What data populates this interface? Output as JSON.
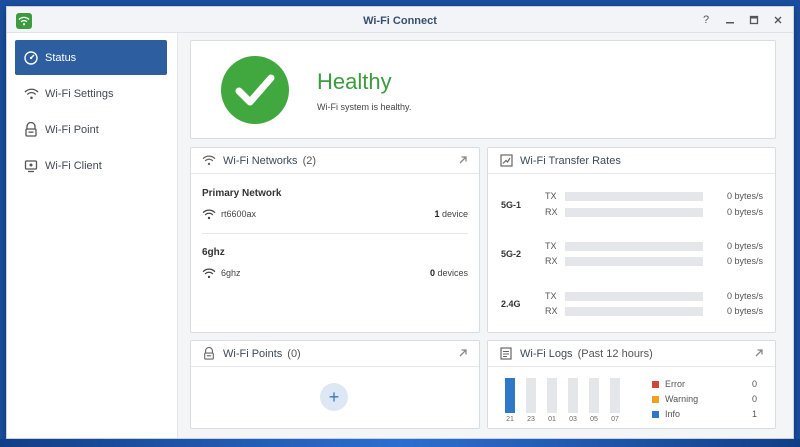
{
  "window": {
    "title": "Wi-Fi Connect"
  },
  "colors": {
    "accent": "#2c5ea0",
    "healthy": "#40a83f",
    "error": "#d0443a",
    "warning": "#f0a11d",
    "info": "#2f78c8"
  },
  "sidebar": {
    "items": [
      {
        "label": "Status",
        "icon": "status-icon",
        "active": true
      },
      {
        "label": "Wi-Fi Settings",
        "icon": "wifi-icon",
        "active": false
      },
      {
        "label": "Wi-Fi Point",
        "icon": "wifi-point-icon",
        "active": false
      },
      {
        "label": "Wi-Fi Client",
        "icon": "client-icon",
        "active": false
      }
    ]
  },
  "health": {
    "status": "Healthy",
    "description": "Wi-Fi system is healthy."
  },
  "networks": {
    "title": "Wi-Fi Networks",
    "count": "(2)",
    "groups": [
      {
        "name": "Primary Network",
        "ssid": "rt6600ax",
        "count": "1",
        "unit": "device"
      },
      {
        "name": "6ghz",
        "ssid": "6ghz",
        "count": "0",
        "unit": "devices"
      }
    ]
  },
  "rates": {
    "title": "Wi-Fi Transfer Rates",
    "bands": [
      {
        "band": "5G-1",
        "tx_label": "TX",
        "tx_value": "0 bytes/s",
        "rx_label": "RX",
        "rx_value": "0 bytes/s"
      },
      {
        "band": "5G-2",
        "tx_label": "TX",
        "tx_value": "0 bytes/s",
        "rx_label": "RX",
        "rx_value": "0 bytes/s"
      },
      {
        "band": "2.4G",
        "tx_label": "TX",
        "tx_value": "0 bytes/s",
        "rx_label": "RX",
        "rx_value": "0 bytes/s"
      }
    ]
  },
  "points": {
    "title": "Wi-Fi Points",
    "count": "(0)",
    "add_label": "+"
  },
  "logs": {
    "title": "Wi-Fi Logs",
    "subtitle": "(Past 12 hours)",
    "chart_data": {
      "type": "bar",
      "categories": [
        "21",
        "23",
        "01",
        "03",
        "05",
        "07"
      ],
      "values": [
        1,
        0,
        0,
        0,
        0,
        0
      ],
      "ylim": [
        0,
        1
      ]
    },
    "legend": [
      {
        "label": "Error",
        "count": "0",
        "color": "#d0443a"
      },
      {
        "label": "Warning",
        "count": "0",
        "color": "#f0a11d"
      },
      {
        "label": "Info",
        "count": "1",
        "color": "#2f78c8"
      }
    ]
  }
}
